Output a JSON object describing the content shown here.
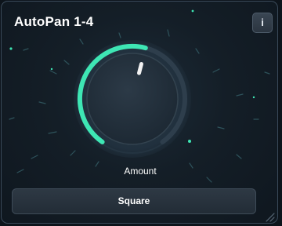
{
  "plugin": {
    "title": "AutoPan 1-4",
    "info_label": "i"
  },
  "knob": {
    "label": "Amount",
    "value": 0.55
  },
  "mode_button": {
    "label": "Square"
  },
  "colors": {
    "accent": "#3ee6b4",
    "indicator": "#f2f2f2",
    "background": "#141e27"
  },
  "icons": {
    "info": "info-icon",
    "resize": "resize-grip-icon"
  }
}
